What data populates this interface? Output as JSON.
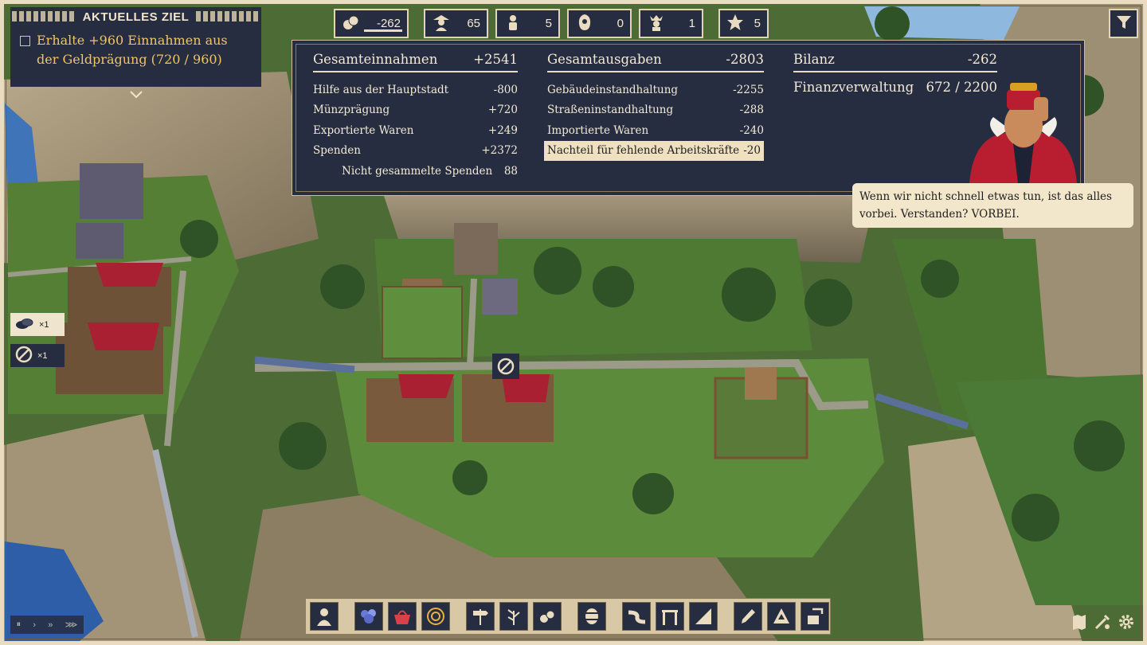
{
  "objective": {
    "header": "AKTUELLES ZIEL",
    "text": "Erhalte +960 Einnahmen aus der Geldprägung (720 / 960)",
    "progress": 0.75,
    "text_color": "#f0c567"
  },
  "resources": [
    {
      "icon": "money-icon",
      "value": "-262"
    },
    {
      "icon": "peasant-icon",
      "value": "65"
    },
    {
      "icon": "worker-icon",
      "value": "5"
    },
    {
      "icon": "monk-icon",
      "value": "0"
    },
    {
      "icon": "noble-icon",
      "value": "1"
    },
    {
      "icon": "star-icon",
      "value": "5"
    }
  ],
  "finance": {
    "income": {
      "title": "Gesamteinnahmen",
      "total": "+2541",
      "rows": [
        {
          "label": "Hilfe aus der Hauptstadt",
          "value": "-800"
        },
        {
          "label": "Münzprägung",
          "value": "+720"
        },
        {
          "label": "Exportierte Waren",
          "value": "+249"
        },
        {
          "label": "Spenden",
          "value": "+2372"
        },
        {
          "label": "Nicht gesammelte Spenden",
          "value": "88"
        }
      ]
    },
    "expenses": {
      "title": "Gesamtausgaben",
      "total": "-2803",
      "rows": [
        {
          "label": "Gebäudeinstandhaltung",
          "value": "-2255"
        },
        {
          "label": "Straßeninstandhaltung",
          "value": "-288"
        },
        {
          "label": "Importierte Waren",
          "value": "-240"
        },
        {
          "label": "Nachteil für fehlende Arbeitskräfte",
          "value": "-20"
        }
      ]
    },
    "balance": {
      "title": "Bilanz",
      "total": "-262",
      "admin_label": "Finanzverwaltung",
      "admin_value": "672 / 2200"
    }
  },
  "advisor": {
    "speech": "Wenn wir nicht schnell etwas tun, ist das alles vorbei. Verstanden? VORBEI."
  },
  "modifiers": [
    {
      "icon": "stones-icon",
      "value": "×1"
    },
    {
      "icon": "ban-icon",
      "value": "×1"
    }
  ],
  "toolbar": [
    "citizen-icon",
    "flowers-icon",
    "basket-icon",
    "mandala-icon",
    "signpost-icon",
    "herbs-icon",
    "merchant-icon",
    "barrel-icon",
    "road-icon",
    "gate-icon",
    "ramp-icon",
    "dropper-icon",
    "upgrade-icon",
    "demolish-icon"
  ],
  "speed_controls": [
    "⏸",
    "›",
    "»",
    "⋙"
  ],
  "colors": {
    "panel": "#262d40",
    "cream": "#efe5cf",
    "gold": "#f0c567"
  }
}
